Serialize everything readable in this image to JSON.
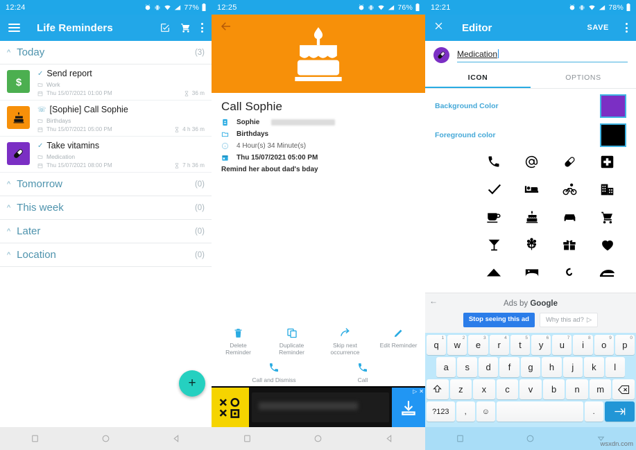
{
  "panel1": {
    "status": {
      "time": "12:24",
      "battery": "77%"
    },
    "appbar": {
      "title": "Life Reminders",
      "menu_icon": "hamburger-icon",
      "edit_icon": "checkbox-edit-icon",
      "cart_icon": "shopping-cart-icon",
      "overflow_icon": "overflow-menu-icon"
    },
    "groups": [
      {
        "name": "Today",
        "count": "(3)"
      },
      {
        "name": "Tomorrow",
        "count": "(0)"
      },
      {
        "name": "This week",
        "count": "(0)"
      },
      {
        "name": "Later",
        "count": "(0)"
      },
      {
        "name": "Location",
        "count": "(0)"
      }
    ],
    "reminders": [
      {
        "title": "Send report",
        "category": "Work",
        "date": "Thu 15/07/2021 01:00 PM",
        "remaining": "36 m",
        "icon": "dollar-icon",
        "icon_bg": "#4caf50",
        "type_icon": "check-icon"
      },
      {
        "title": "[Sophie] Call Sophie",
        "category": "Birthdays",
        "date": "Thu 15/07/2021 05:00 PM",
        "remaining": "4 h 36 m",
        "icon": "birthday-cake-icon",
        "icon_bg": "#f79009",
        "type_icon": "phone-icon"
      },
      {
        "title": "Take vitamins",
        "category": "Medication",
        "date": "Thu 15/07/2021 08:00 PM",
        "remaining": "7 h 36 m",
        "icon": "pill-icon",
        "icon_bg": "#7b2fc4",
        "type_icon": "check-icon"
      }
    ],
    "fab": {
      "label": "+",
      "color": "#25d0c0",
      "name": "add-reminder-fab"
    }
  },
  "panel2": {
    "status": {
      "time": "12:25",
      "battery": "76%"
    },
    "hero": {
      "color": "#f79009",
      "icon": "birthday-cake-icon",
      "back_icon": "back-arrow-icon"
    },
    "detail": {
      "title": "Call Sophie",
      "contact": "Sophie",
      "category": "Birthdays",
      "duration": "4 Hour(s) 34 Minute(s)",
      "datetime": "Thu 15/07/2021 05:00 PM",
      "note": "Remind her about dad's bday"
    },
    "actions_row1": [
      {
        "label": "Delete\nReminder",
        "line1": "Delete",
        "line2": "Reminder",
        "icon": "trash-icon"
      },
      {
        "label": "Duplicate Reminder",
        "line1": "Duplicate",
        "line2": "Reminder",
        "icon": "copy-icon"
      },
      {
        "label": "Skip next occurrence",
        "line1": "Skip next",
        "line2": "occurrence",
        "icon": "skip-arrow-icon"
      },
      {
        "label": "Edit Reminder",
        "line1": "Edit Reminder",
        "line2": "",
        "icon": "pencil-icon"
      }
    ],
    "actions_row2": [
      {
        "label": "Call and Dismiss",
        "line1": "Call and Dismiss",
        "line2": "",
        "icon": "phone-icon"
      },
      {
        "label": "Call",
        "line1": "Call",
        "line2": "",
        "icon": "phone-icon"
      }
    ],
    "ad": {
      "logo_text": "XOXO",
      "cta_icon": "download-icon",
      "close_icon": "close-x-icon",
      "play_icon": "adchoices-icon"
    }
  },
  "panel3": {
    "status": {
      "time": "12:21",
      "battery": "78%"
    },
    "appbar": {
      "close_icon": "close-x-icon",
      "title": "Editor",
      "save_label": "SAVE",
      "overflow_icon": "overflow-menu-icon"
    },
    "name_field": {
      "value": "Medication",
      "avatar_icon": "pill-icon",
      "avatar_bg": "#7b2fc4"
    },
    "tabs": [
      {
        "label": "ICON",
        "active": true
      },
      {
        "label": "OPTIONS",
        "active": false
      }
    ],
    "colors": [
      {
        "label": "Background Color",
        "value": "#7b2fc4"
      },
      {
        "label": "Foreground color",
        "value": "#000000"
      }
    ],
    "icons": [
      "phone-icon",
      "at-sign-icon",
      "pill-icon",
      "first-aid-icon",
      "check-icon",
      "bed-icon",
      "bicycle-icon",
      "building-icon",
      "coffee-cup-icon",
      "birthday-cake-icon",
      "car-icon",
      "shopping-cart-icon",
      "cocktail-glass-icon",
      "flower-icon",
      "gift-icon",
      "heart-icon",
      "mountain-icon",
      "gamepad-icon",
      "hook-icon",
      "sofa-icon"
    ],
    "ads_by": {
      "title_prefix": "Ads by ",
      "title_brand": "Google",
      "stop_label": "Stop seeing this ad",
      "why_label": "Why this ad?",
      "back_icon": "back-arrow-icon"
    },
    "keyboard": {
      "row1": [
        {
          "k": "q",
          "n": "1"
        },
        {
          "k": "w",
          "n": "2"
        },
        {
          "k": "e",
          "n": "3"
        },
        {
          "k": "r",
          "n": "4"
        },
        {
          "k": "t",
          "n": "5"
        },
        {
          "k": "y",
          "n": "6"
        },
        {
          "k": "u",
          "n": "7"
        },
        {
          "k": "i",
          "n": "8"
        },
        {
          "k": "o",
          "n": "9"
        },
        {
          "k": "p",
          "n": "0"
        }
      ],
      "row2": [
        "a",
        "s",
        "d",
        "f",
        "g",
        "h",
        "j",
        "k",
        "l"
      ],
      "row3_shift": "shift-icon",
      "row3": [
        "z",
        "x",
        "c",
        "v",
        "b",
        "n",
        "m"
      ],
      "row3_back": "backspace-icon",
      "row4": {
        "sym": "?123",
        "comma": ",",
        "emoji": "emoji-icon",
        "space": "",
        "period": ".",
        "enter": "enter-icon"
      }
    }
  },
  "navbar": {
    "recent_icon": "square-icon",
    "home_icon": "circle-icon",
    "back_icon": "triangle-back-icon"
  },
  "watermark": "wsxdn.com"
}
